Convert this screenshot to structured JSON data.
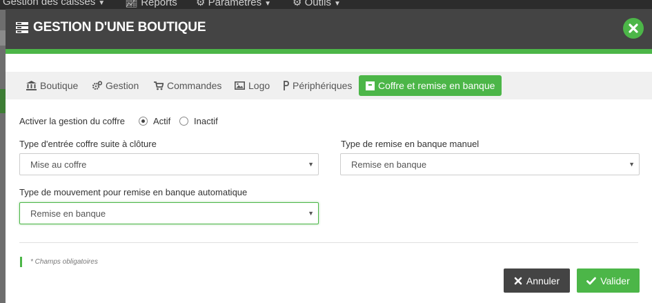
{
  "background": {
    "nav": [
      {
        "label": "Gestion des caisses",
        "icon": "none"
      },
      {
        "label": "Reports",
        "icon": "chart-icon"
      },
      {
        "label": "Paramètres",
        "icon": "gear-icon"
      },
      {
        "label": "Outils",
        "icon": "gear-icon"
      }
    ]
  },
  "modal": {
    "title": "GESTION D'UNE BOUTIQUE",
    "tabs": [
      {
        "label": "Boutique",
        "icon": "bank-icon"
      },
      {
        "label": "Gestion",
        "icon": "gears-icon"
      },
      {
        "label": "Commandes",
        "icon": "cart-icon"
      },
      {
        "label": "Logo",
        "icon": "image-icon"
      },
      {
        "label": "Périphériques",
        "icon": "plug-icon"
      },
      {
        "label": "Coffre et remise en banque",
        "icon": "archive-icon",
        "active": true
      }
    ],
    "form": {
      "coffre_label": "Activer la gestion du coffre",
      "radio_actif": "Actif",
      "radio_inactif": "Inactif",
      "selected_radio": "Actif",
      "entree_label": "Type d'entrée coffre suite à clôture",
      "entree_value": "Mise au coffre",
      "remise_manuel_label": "Type de remise en banque manuel",
      "remise_manuel_value": "Remise en banque",
      "remise_auto_label": "Type de mouvement pour remise en banque automatique",
      "remise_auto_value": "Remise en banque"
    },
    "required_note": "* Champs obligatoires",
    "buttons": {
      "cancel": "Annuler",
      "ok": "Valider"
    }
  },
  "colors": {
    "accent": "#4cb648",
    "header": "#444444",
    "tabs_bg": "#f0f0f0"
  }
}
